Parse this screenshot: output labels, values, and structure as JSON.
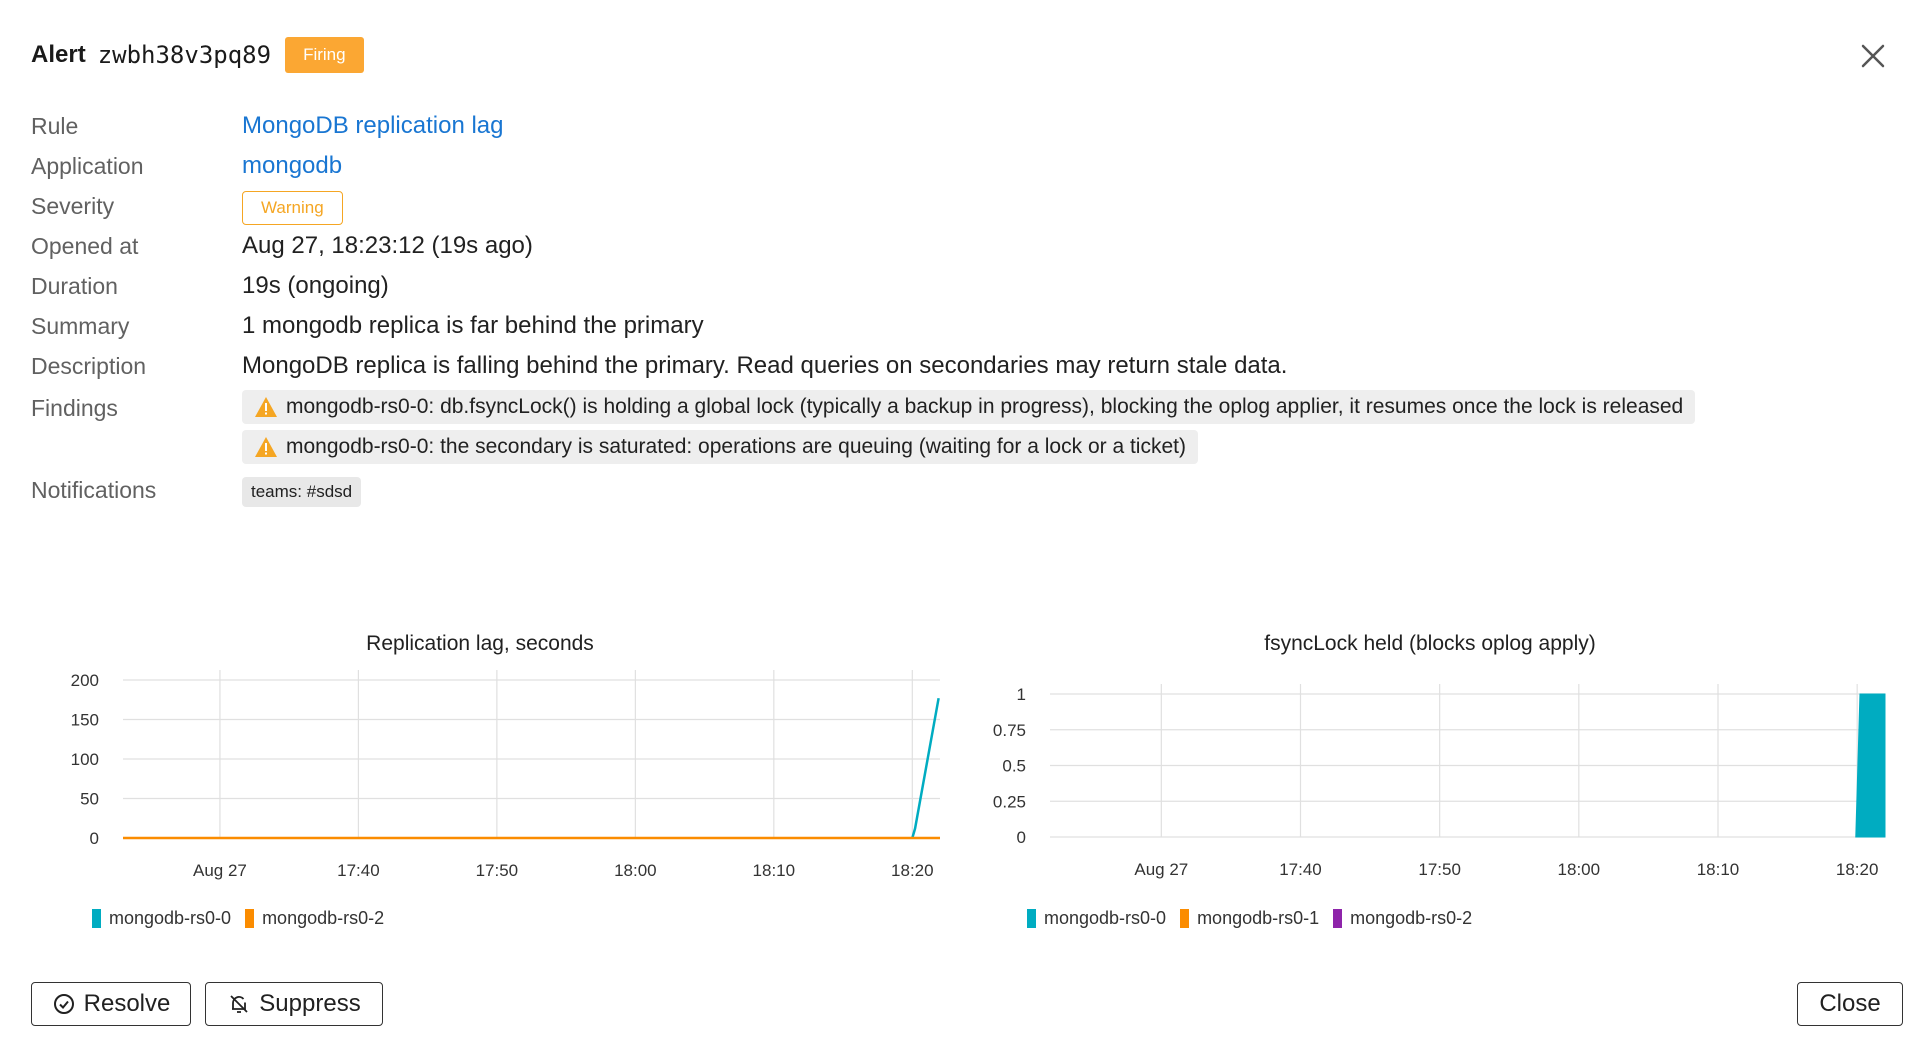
{
  "header": {
    "alert_word": "Alert",
    "alert_id": "zwbh38v3pq89",
    "status": "Firing",
    "status_color": "#fba733"
  },
  "details": {
    "rule_label": "Rule",
    "rule_value": "MongoDB replication lag",
    "application_label": "Application",
    "application_value": "mongodb",
    "severity_label": "Severity",
    "severity_value": "Warning",
    "opened_label": "Opened at",
    "opened_value": "Aug 27, 18:23:12 (19s ago)",
    "duration_label": "Duration",
    "duration_value": "19s (ongoing)",
    "summary_label": "Summary",
    "summary_value": "1 mongodb replica is far behind the primary",
    "description_label": "Description",
    "description_value": "MongoDB replica is falling behind the primary. Read queries on secondaries may return stale data.",
    "findings_label": "Findings",
    "findings": [
      "mongodb-rs0-0: db.fsyncLock() is holding a global lock (typically a backup in progress), blocking the oplog applier, it resumes once the lock is released",
      "mongodb-rs0-0: the secondary is saturated: operations are queuing (waiting for a lock or a ticket)"
    ],
    "notifications_label": "Notifications",
    "notifications_value": "teams: #sdsd"
  },
  "colors": {
    "link": "#1976d2",
    "warning": "#f5a623",
    "series_teal": "#00acc1",
    "series_orange": "#fb8c00",
    "series_purple": "#8e24aa"
  },
  "chart_data": [
    {
      "type": "line",
      "title": "Replication lag, seconds",
      "x_ticks": [
        "Aug 27",
        "17:40",
        "17:50",
        "18:00",
        "18:10",
        "18:20"
      ],
      "x_range_minutes": [
        -7,
        52
      ],
      "y_ticks": [
        "0",
        "50",
        "100",
        "150",
        "200"
      ],
      "ylim": [
        0,
        200
      ],
      "grid": true,
      "legend_position": "bottom-left",
      "series": [
        {
          "name": "mongodb-rs0-0",
          "color": "#00acc1",
          "points": [
            [
              50,
              0
            ],
            [
              50.2,
              12
            ],
            [
              51.9,
              177
            ]
          ]
        },
        {
          "name": "mongodb-rs0-2",
          "color": "#fb8c00",
          "points": [
            [
              -7,
              0
            ],
            [
              52,
              0
            ]
          ]
        }
      ]
    },
    {
      "type": "area",
      "title": "fsyncLock held (blocks oplog apply)",
      "x_ticks": [
        "Aug 27",
        "17:40",
        "17:50",
        "18:00",
        "18:10",
        "18:20"
      ],
      "x_range_minutes": [
        -8,
        52
      ],
      "y_ticks": [
        "0",
        "0.25",
        "0.5",
        "0.75",
        "1"
      ],
      "ylim": [
        0,
        1
      ],
      "grid": true,
      "legend_position": "bottom-left",
      "series": [
        {
          "name": "mongodb-rs0-0",
          "color": "#00acc1",
          "points": [
            [
              49.9,
              0
            ],
            [
              50.2,
              1
            ],
            [
              52,
              1
            ],
            [
              52,
              0
            ]
          ]
        },
        {
          "name": "mongodb-rs0-1",
          "color": "#fb8c00",
          "points": []
        },
        {
          "name": "mongodb-rs0-2",
          "color": "#8e24aa",
          "points": []
        }
      ]
    }
  ],
  "buttons": {
    "resolve": "Resolve",
    "suppress": "Suppress",
    "close": "Close"
  },
  "icons": {
    "close": "close-icon",
    "warning": "warning-triangle-icon",
    "resolve": "check-circle-icon",
    "suppress": "bell-off-icon"
  }
}
